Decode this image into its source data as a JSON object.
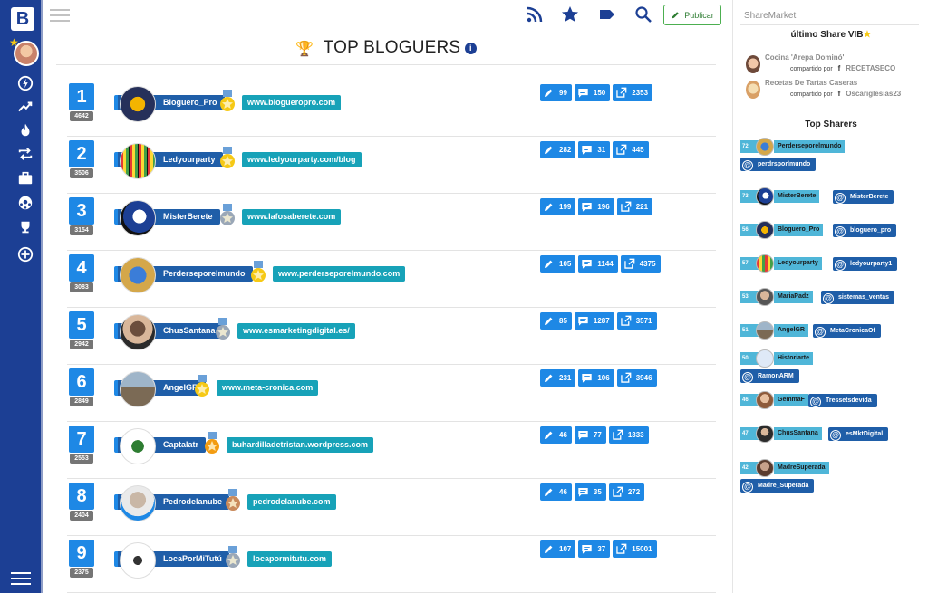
{
  "topbar": {
    "publish_label": "Publicar"
  },
  "page": {
    "title": "TOP BLOGUERS",
    "info_glyph": "i"
  },
  "bloggers": [
    {
      "rank": "1",
      "score": "4642",
      "name": "Bloguero_Pro",
      "url": "www.blogueropro.com",
      "posts": "99",
      "comments": "150",
      "shares": "2353",
      "medal": "gold"
    },
    {
      "rank": "2",
      "score": "3506",
      "name": "Ledyourparty",
      "url": "www.ledyourparty.com/blog",
      "posts": "282",
      "comments": "31",
      "shares": "445",
      "medal": "gold"
    },
    {
      "rank": "3",
      "score": "3154",
      "name": "MisterBerete",
      "url": "www.lafosaberete.com",
      "posts": "199",
      "comments": "196",
      "shares": "221",
      "medal": "silver"
    },
    {
      "rank": "4",
      "score": "3083",
      "name": "Perderseporelmundo",
      "url": "www.perderseporelmundo.com",
      "posts": "105",
      "comments": "1144",
      "shares": "4375",
      "medal": "gold"
    },
    {
      "rank": "5",
      "score": "2942",
      "name": "ChusSantana",
      "url": "www.esmarketingdigital.es/",
      "posts": "85",
      "comments": "1287",
      "shares": "3571",
      "medal": "silver"
    },
    {
      "rank": "6",
      "score": "2849",
      "name": "AngelGR",
      "url": "www.meta-cronica.com",
      "posts": "231",
      "comments": "106",
      "shares": "3946",
      "medal": "gold"
    },
    {
      "rank": "7",
      "score": "2553",
      "name": "Captalatr",
      "url": "buhardilladetristan.wordpress.com",
      "posts": "46",
      "comments": "77",
      "shares": "1333",
      "medal": "orange"
    },
    {
      "rank": "8",
      "score": "2404",
      "name": "Pedrodelanube",
      "url": "pedrodelanube.com",
      "posts": "46",
      "comments": "35",
      "shares": "272",
      "medal": "bronze"
    },
    {
      "rank": "9",
      "score": "2375",
      "name": "LocaPorMiTutú",
      "url": "locapormitutu.com",
      "posts": "107",
      "comments": "37",
      "shares": "15001",
      "medal": "silver"
    }
  ],
  "sidebar": {
    "brand": "ShareMarket",
    "vib_title": "último Share VIB",
    "recent_shares": [
      {
        "title": "Cocina 'Arepa Dominó'",
        "shared_by_label": "compartido por",
        "user": "RECETASECO"
      },
      {
        "title": "Recetas De Tartas Caseras",
        "shared_by_label": "compartido por",
        "user": "Oscariglesias23"
      }
    ],
    "top_sharers_title": "Top Sharers",
    "top_sharers": [
      {
        "count": "72",
        "name": "Perderseporelmundo",
        "handle": "perdrsporlmundo"
      },
      {
        "count": "73",
        "name": "MisterBerete",
        "handle": "MisterBerete"
      },
      {
        "count": "56",
        "name": "Bloguero_Pro",
        "handle": "bloguero_pro"
      },
      {
        "count": "57",
        "name": "Ledyourparty",
        "handle": "ledyourparty1"
      },
      {
        "count": "53",
        "name": "MariaPadz",
        "handle": "sistemas_ventas"
      },
      {
        "count": "51",
        "name": "AngelGR",
        "handle": "MetaCronicaOf"
      },
      {
        "count": "50",
        "name": "Historiarte",
        "handle": "RamonARM"
      },
      {
        "count": "46",
        "name": "GemmaF",
        "handle": "Tressetsdevida"
      },
      {
        "count": "47",
        "name": "ChusSantana",
        "handle": "esMktDigital"
      },
      {
        "count": "42",
        "name": "MadreSuperada",
        "handle": "Madre_Superada"
      }
    ]
  }
}
